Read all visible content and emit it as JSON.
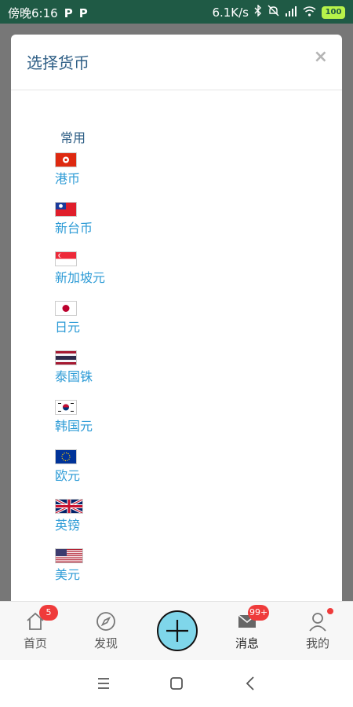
{
  "status_bar": {
    "time": "傍晚6:16",
    "app_badges": [
      "P",
      "P"
    ],
    "network_speed": "6.1K/s",
    "battery": "100"
  },
  "modal": {
    "title": "选择货币",
    "close_label": "×",
    "section_label": "常用",
    "currencies": [
      {
        "name": "港币",
        "flag": "hk"
      },
      {
        "name": "新台币",
        "flag": "tw"
      },
      {
        "name": "新加坡元",
        "flag": "sg"
      },
      {
        "name": "日元",
        "flag": "jp"
      },
      {
        "name": "泰国铢",
        "flag": "th"
      },
      {
        "name": "韩国元",
        "flag": "kr"
      },
      {
        "name": "欧元",
        "flag": "eu"
      },
      {
        "name": "英镑",
        "flag": "gb"
      },
      {
        "name": "美元",
        "flag": "us"
      }
    ]
  },
  "bottom_nav": {
    "home": {
      "label": "首页",
      "badge": "5"
    },
    "discover": {
      "label": "发现"
    },
    "messages": {
      "label": "消息",
      "badge": "99+"
    },
    "mine": {
      "label": "我的"
    }
  },
  "colors": {
    "status_bar": "#1f5a45",
    "title": "#2f5f86",
    "link": "#2d9bd6",
    "badge": "#ef3b3b",
    "fab": "#7fd6ea"
  }
}
